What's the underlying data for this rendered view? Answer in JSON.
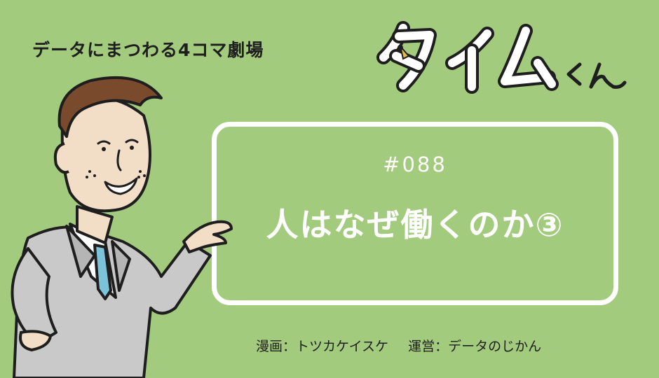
{
  "tagline": "データにまつわる4コマ劇場",
  "logo": {
    "main": "タイム",
    "suffix": "くん",
    "icon": "clock-hand-icon"
  },
  "episode": {
    "number": "#088",
    "title": "人はなぜ働くのか③"
  },
  "credits": {
    "illustration": "漫画：トツカケイスケ",
    "operation": "運営：データのじかん"
  },
  "colors": {
    "background": "#a3cb7d",
    "card_border": "#ffffff",
    "logo_fill": "#ffffff",
    "text": "#1e1e1e",
    "accent": "#e6b84a"
  }
}
